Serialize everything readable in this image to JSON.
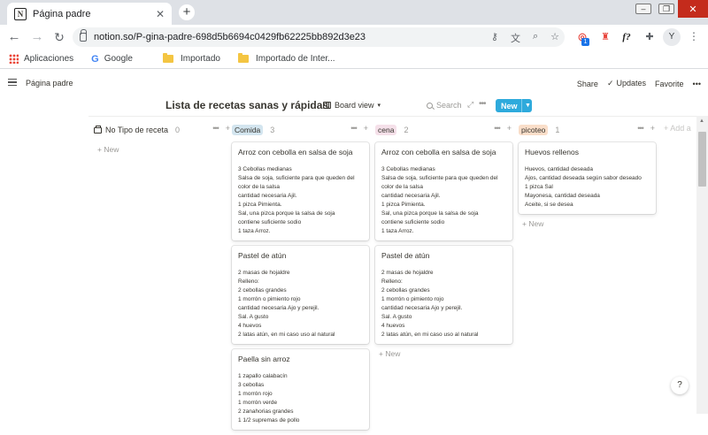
{
  "browser": {
    "tab_title": "Página padre",
    "url": "notion.so/P-gina-padre-698d5b6694c0429fb62225bb892d3e23",
    "ext_badge": "1",
    "ext_f": "f?",
    "avatar_letter": "Y",
    "bookmarks": [
      "Aplicaciones",
      "Google",
      "Importado",
      "Importado de Inter..."
    ]
  },
  "topbar": {
    "breadcrumb": "Página padre",
    "share": "Share",
    "updates": "Updates",
    "favorite": "Favorite"
  },
  "database": {
    "title": "Lista de recetas sanas y rápidas",
    "view": "Board view",
    "search": "Search",
    "new_button": "New"
  },
  "columns": [
    {
      "name": "No Tipo de receta",
      "count": "0",
      "tag_bg": "",
      "new_label": "+ New",
      "cards": []
    },
    {
      "name": "Comida",
      "count": "3",
      "tag_bg": "#d3e5ef",
      "new_label": "",
      "cards": [
        {
          "title": "Arroz con cebolla en salsa de soja",
          "lines": [
            "3 Cebollas medianas",
            "Salsa de soja, suficiente para que queden del",
            "color de la salsa",
            "cantidad necesaria Ajil.",
            "1 pizca Pimienta.",
            "Sal, una pizca porque la salsa de soja",
            "contiene suficiente sodio",
            "1 taza Arroz."
          ]
        },
        {
          "title": "Pastel de atún",
          "lines": [
            "2 masas de hojaldre",
            "Relleno:",
            "2 cebollas grandes",
            "1 morrón o pimiento rojo",
            "cantidad necesaria Ajo y perejil.",
            "Sal. A gusto",
            "4 huevos",
            "2 latas atún, en mi caso uso al natural"
          ]
        },
        {
          "title": "Paella sin arroz",
          "lines": [
            "1 zapallo calabacín",
            "3 cebollas",
            "1 morrón rojo",
            "1 morrón verde",
            "2 zanahorias grandes",
            "1 1/2 supremas de pollo"
          ]
        }
      ]
    },
    {
      "name": "cena",
      "count": "2",
      "tag_bg": "#f5e0e9",
      "new_label": "+ New",
      "cards": [
        {
          "title": "Arroz con cebolla en salsa de soja",
          "lines": [
            "3 Cebollas medianas",
            "Salsa de soja, suficiente para que queden del",
            "color de la salsa",
            "cantidad necesaria Ajil.",
            "1 pizca Pimienta.",
            "Sal, una pizca porque la salsa de soja",
            "contiene suficiente sodio",
            "1 taza Arroz."
          ]
        },
        {
          "title": "Pastel de atún",
          "lines": [
            "2 masas de hojaldre",
            "Relleno:",
            "2 cebollas grandes",
            "1 morrón o pimiento rojo",
            "cantidad necesaria Ajo y perejil.",
            "Sal. A gusto",
            "4 huevos",
            "2 latas atún, en mi caso uso al natural"
          ]
        }
      ]
    },
    {
      "name": "picoteo",
      "count": "1",
      "tag_bg": "#fadec9",
      "new_label": "+ New",
      "cards": [
        {
          "title": "Huevos rellenos",
          "lines": [
            "Huevos, cantidad deseada",
            "Ajos, cantidad deseada según sabor deseado",
            "1 pizca Sal",
            "Mayonesa, cantidad deseada",
            "Aceite, si se desea"
          ]
        }
      ]
    }
  ],
  "add_group": "+ Add a",
  "help": "?"
}
